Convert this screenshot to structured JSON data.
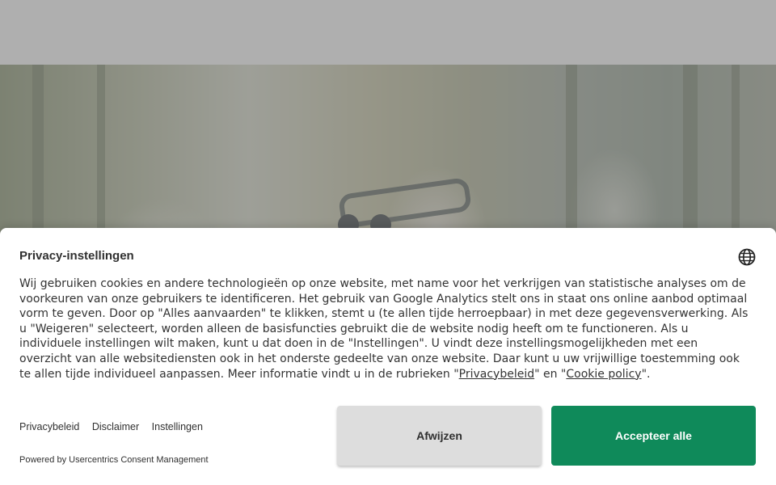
{
  "banner": {
    "title": "Privacy-instellingen",
    "language_icon": "globe-icon",
    "description_main": "Wij gebruiken cookies en andere technologieën op onze website, met name voor het verkrijgen van statistische analyses om de voorkeuren van onze gebruikers te identificeren. Het gebruik van Google Analytics stelt ons in staat ons online aanbod optimaal vorm te geven. Door op \"Alles aanvaarden\" te klikken, stemt u (te allen tijde herroepbaar) in met deze gegevensverwerking. Als u \"Weigeren\" selecteert, worden alleen de basisfuncties gebruikt die de website nodig heeft om te functioneren. Als u individuele instellingen wilt maken, kunt u dat doen in de \"Instellingen\". U vindt deze instellingsmogelijkheden met een overzicht van alle websitediensten ook in het onderste gedeelte van onze website. Daar kunt u uw vrijwillige toestemming ook te allen tijde individueel aanpassen. Meer informatie vindt u in de rubrieken",
    "quote_open_1": " \"",
    "privacy_link": "Privacybeleid",
    "between_links": "\" en \"",
    "cookie_link": "Cookie policy",
    "end": "\".",
    "footer_links": [
      "Privacybeleid",
      "Disclaimer",
      "Instellingen"
    ],
    "powered_by": "Powered by Usercentrics Consent Management",
    "deny_button": "Afwijzen",
    "accept_button": "Accepteer alle"
  },
  "colors": {
    "accent": "#0f8a5a",
    "deny_bg": "#dddddd",
    "overlay": "rgba(110,110,110,0.55)"
  }
}
